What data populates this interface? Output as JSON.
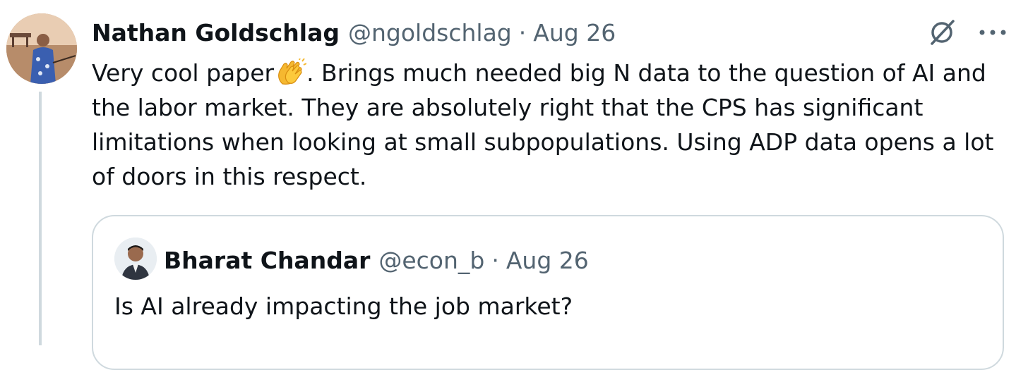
{
  "tweet": {
    "author_name": "Nathan Goldschlag",
    "author_handle": "@ngoldschlag",
    "separator": "·",
    "date": "Aug 26",
    "text_lines": [
      "Very cool paper",
      ". Brings much needed big N data to the question of AI and",
      "the labor market. They are absolutely right that the CPS has significant",
      "limitations when looking at small subpopulations. Using ADP data opens a lot",
      "of doors in this respect."
    ],
    "emoji_icon": "clapping-hands-icon",
    "top_right_icons": [
      "grok-slash-icon",
      "more-options-icon"
    ]
  },
  "quote": {
    "author_name": "Bharat Chandar",
    "author_handle": "@econ_b",
    "separator": "·",
    "date": "Aug 26",
    "text": "Is AI already impacting the job market?"
  },
  "colors": {
    "primary_text": "#0f1419",
    "secondary_text": "#536471",
    "border": "#cfd9de",
    "thread_line": "#cfd9de"
  }
}
